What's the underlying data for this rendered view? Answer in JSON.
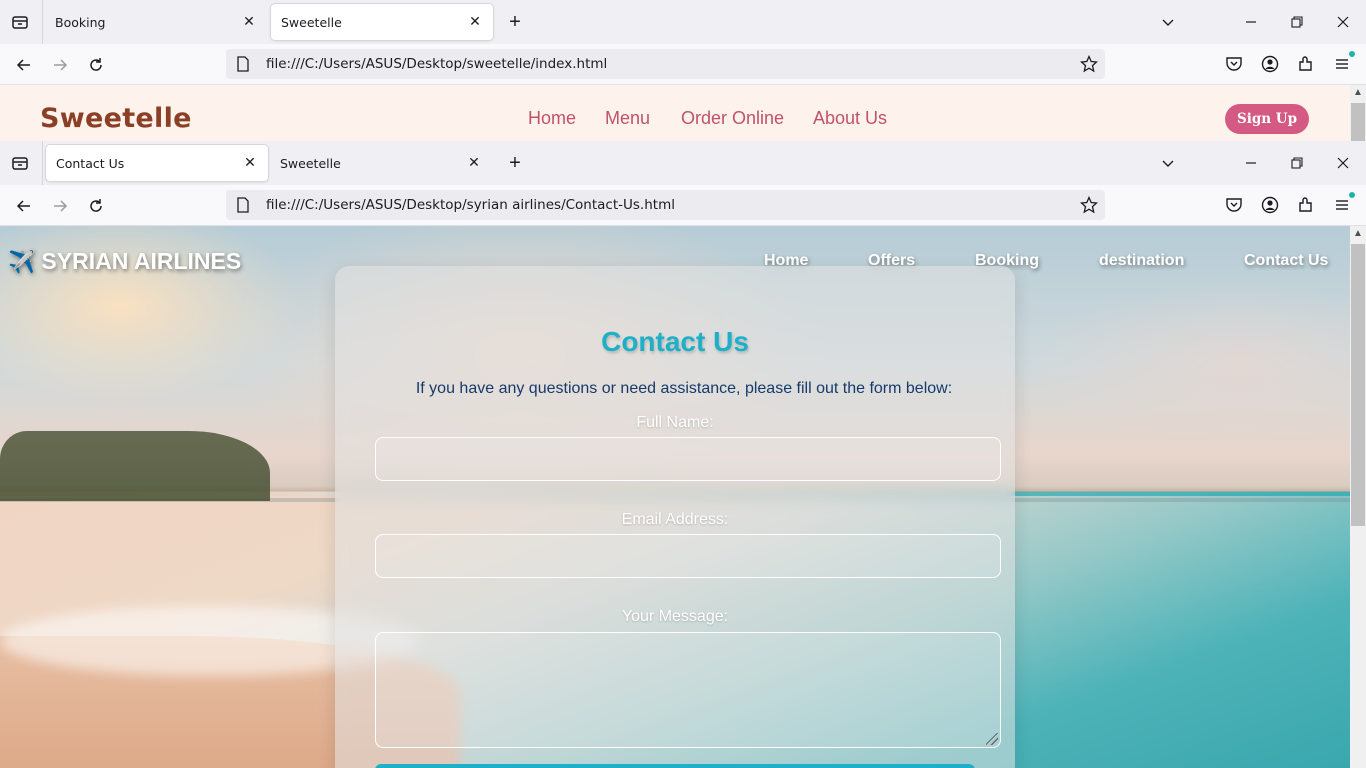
{
  "window_top": {
    "tabs": [
      {
        "title": "Booking",
        "active": false
      },
      {
        "title": "Sweetelle",
        "active": true
      }
    ],
    "url": "file:///C:/Users/ASUS/Desktop/sweetelle/index.html"
  },
  "sweetelle": {
    "logo": "Sweetelle",
    "nav": [
      "Home",
      "Menu",
      "Order Online",
      "About Us"
    ],
    "signup": "Sign Up",
    "colors": {
      "background": "#fef3ec",
      "logo": "#8b3f26",
      "nav": "#c0526a",
      "button": "#d55a83"
    }
  },
  "window_second": {
    "tabs": [
      {
        "title": "Contact Us",
        "active": true
      },
      {
        "title": "Sweetelle",
        "active": false
      }
    ],
    "url": "file:///C:/Users/ASUS/Desktop/syrian airlines/Contact-Us.html"
  },
  "airlines": {
    "brand": "SYRIAN AIRLINES",
    "brand_icon": "airplane-icon",
    "nav": [
      "Home",
      "Offers",
      "Booking",
      "destination",
      "Contact Us"
    ],
    "contact": {
      "title": "Contact Us",
      "intro": "If you have any questions or need assistance, please fill out the form below:",
      "fields": [
        {
          "label": "Full Name:",
          "value": ""
        },
        {
          "label": "Email Address:",
          "value": ""
        },
        {
          "label": "Your Message:",
          "value": ""
        }
      ]
    },
    "colors": {
      "title": "#1fb0c9",
      "intro": "#163a6b",
      "submit": "#1fb0c9"
    }
  }
}
